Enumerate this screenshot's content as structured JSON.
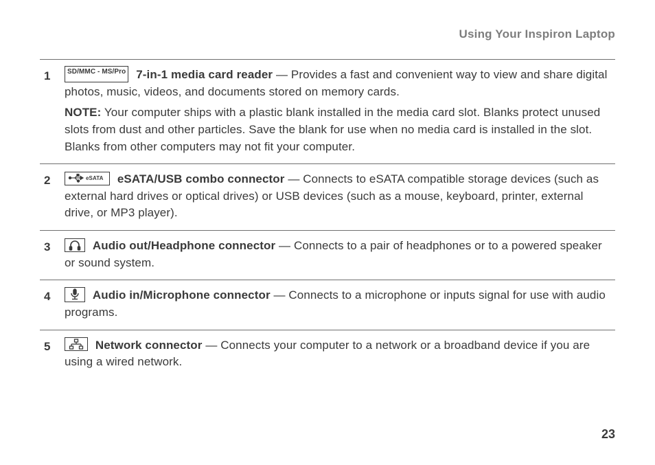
{
  "header": {
    "running_title": "Using Your Inspiron Laptop"
  },
  "items": [
    {
      "num": "1",
      "icon_label": "SD/MMC - MS/Pro",
      "title": "7-in-1 media card reader",
      "desc": " — Provides a fast and convenient way to view and share digital photos, music, videos, and documents stored on memory cards.",
      "note_label": "NOTE:",
      "note": " Your computer ships with a plastic blank installed in the media card slot. Blanks protect unused slots from dust and other particles. Save the blank for use when no media card is installed in the slot. Blanks from other computers may not fit your computer."
    },
    {
      "num": "2",
      "icon_label": "eSATA",
      "title": "eSATA/USB combo connector",
      "desc": " — Connects to eSATA compatible storage devices (such as external hard drives or optical drives) or USB devices (such as a mouse, keyboard, printer, external drive, or MP3 player)."
    },
    {
      "num": "3",
      "title": "Audio out/Headphone connector",
      "desc": " — Connects to a pair of headphones or to a powered speaker or sound system."
    },
    {
      "num": "4",
      "title": "Audio in/Microphone connector",
      "desc": " — Connects to a microphone or inputs signal for use with audio programs."
    },
    {
      "num": "5",
      "title": "Network connector",
      "desc": " — Connects your computer to a network or a broadband device if you are using a wired network."
    }
  ],
  "page_number": "23"
}
